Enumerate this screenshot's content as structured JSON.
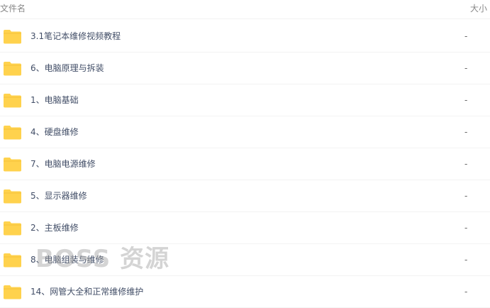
{
  "header": {
    "name_label": "文件名",
    "size_label": "大小"
  },
  "folder_color": "#ffd24d",
  "files": [
    {
      "name": "3.1笔记本维修视频教程",
      "size": "-",
      "icon": "folder-icon"
    },
    {
      "name": "6、电脑原理与拆装",
      "size": "-",
      "icon": "folder-icon"
    },
    {
      "name": "1、电脑基础",
      "size": "-",
      "icon": "folder-icon"
    },
    {
      "name": "4、硬盘维修",
      "size": "-",
      "icon": "folder-icon"
    },
    {
      "name": "7、电脑电源维修",
      "size": "-",
      "icon": "folder-icon"
    },
    {
      "name": "5、显示器维修",
      "size": "-",
      "icon": "folder-icon"
    },
    {
      "name": "2、主板维修",
      "size": "-",
      "icon": "folder-icon"
    },
    {
      "name": "8、电脑组装与维修",
      "size": "-",
      "icon": "folder-icon"
    },
    {
      "name": "14、网管大全和正常维修维护",
      "size": "-",
      "icon": "folder-icon"
    }
  ],
  "watermark": "BOSS 资源"
}
